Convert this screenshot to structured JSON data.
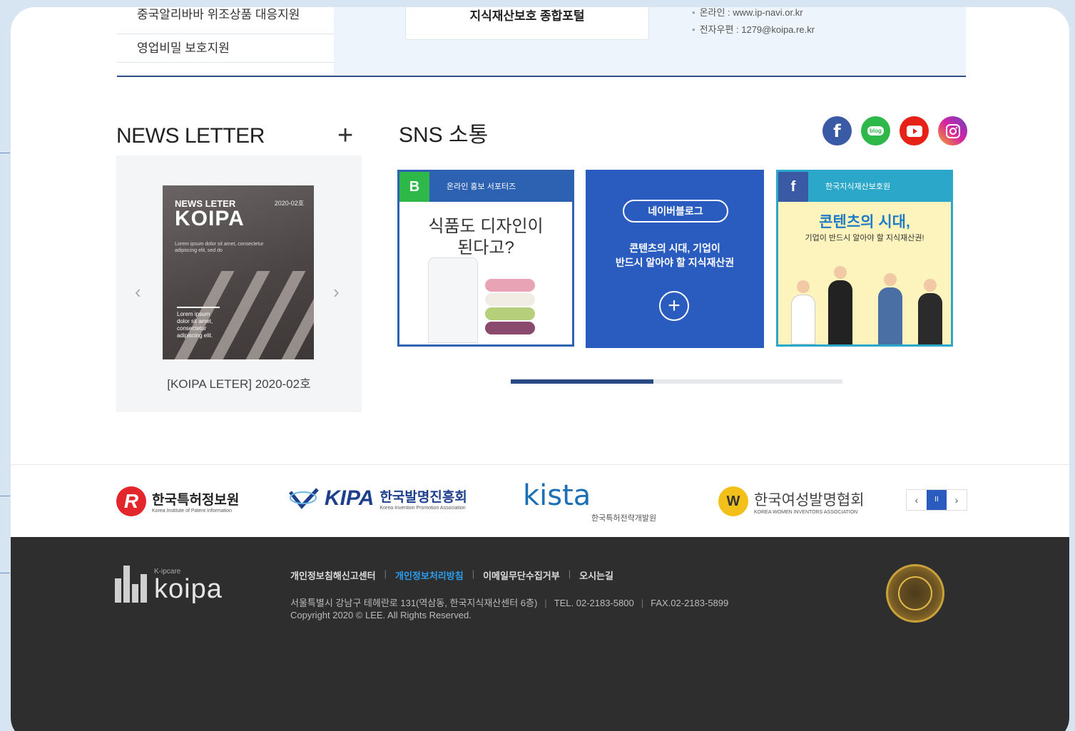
{
  "top": {
    "menu_items": [
      "중국알리바바 위조상품 대응지원",
      "영업비밀 보호지원"
    ],
    "portal_button": "지식재산보호 종합포털",
    "contact": [
      "온라인 : www.ip-navi.or.kr",
      "전자우편 : 1279@koipa.re.kr"
    ]
  },
  "newsletter": {
    "title": "NEWS LETTER",
    "more_icon": "plus-icon",
    "cover": {
      "header": "NEWS LETER",
      "brand": "KOIPA",
      "issue": "2020-02호",
      "blurb": "Lorem ipsum dolor sit amet, consectetur adipiscing elit, sed do",
      "footer": "Lorem ipsum dolor sit amet, consectetur adipiscing elit."
    },
    "caption": "[KOIPA LETER] 2020-02호",
    "prev_icon": "‹",
    "next_icon": "›"
  },
  "sns": {
    "title": "SNS 소통",
    "icons": [
      "facebook-icon",
      "blog-icon",
      "youtube-icon",
      "instagram-icon"
    ],
    "blog_label": "blog",
    "cards": [
      {
        "badge": "B",
        "banner": "온라인 홍보 서포터즈",
        "headline1": "식품도 디자인이",
        "headline2": "된다고?"
      },
      {
        "pill": "네이버블로그",
        "line1": "콘텐츠의 시대, 기업이",
        "line2": "반드시 알아야 할 지식재산권"
      },
      {
        "badge": "f",
        "banner": "한국지식재산보호원",
        "headline1": "콘텐츠의 시대,",
        "headline2": "기업이 반드시 알아야 할 지식재산권!"
      }
    ],
    "progress": 0.43
  },
  "partners": {
    "items": [
      {
        "name": "한국특허정보원",
        "sub": "Korea Institute of Patent Information"
      },
      {
        "name": "한국발명진흥회",
        "sub": "Korea Invention Promotion Association",
        "mark": "KIPA"
      },
      {
        "name": "한국특허전략개발원",
        "mark": "kista"
      },
      {
        "name": "한국여성발명협회",
        "sub": "KOREA WOMEN INVENTORS ASSOCIATION"
      }
    ],
    "pager": {
      "prev": "‹",
      "pause": "II",
      "next": "›"
    }
  },
  "footer": {
    "logo_small": "K-ipcare",
    "logo": "koipa",
    "links": [
      "개인정보침해신고센터",
      "개인정보처리방침",
      "이메일무단수집거부",
      "오시는길"
    ],
    "address": "서울특별시 강남구 테헤란로 131(역삼동, 한국지식재산센터 6층)",
    "tel": "TEL. 02-2183-5800",
    "fax": "FAX.02-2183-5899",
    "copyright": "Copyright 2020 © LEE. All Rights Reserved."
  }
}
